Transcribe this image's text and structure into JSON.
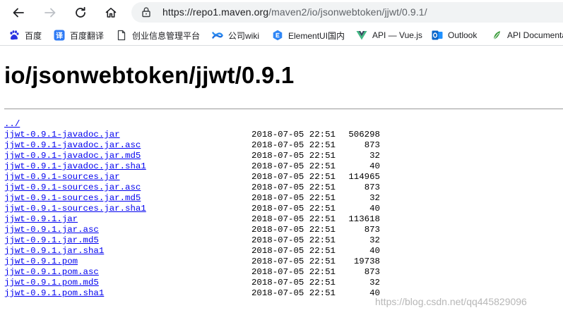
{
  "browser": {
    "url_host": "https://repo1.maven.org",
    "url_path": "/maven2/io/jsonwebtoken/jjwt/0.9.1/"
  },
  "bookmarks": [
    {
      "label": "百度",
      "icon": "baidu-paw-icon",
      "color": "#2932e1"
    },
    {
      "label": "百度翻译",
      "icon": "baidu-translate-icon",
      "color": "#2f7bf5"
    },
    {
      "label": "创业信息管理平台",
      "icon": "page-icon",
      "color": "#5f6368"
    },
    {
      "label": "公司wiki",
      "icon": "confluence-icon",
      "color": "#1d6fe0"
    },
    {
      "label": "ElementUI国内",
      "icon": "element-icon",
      "color": "#2f86f6"
    },
    {
      "label": "API — Vue.js",
      "icon": "vue-icon",
      "color": "#42b883"
    },
    {
      "label": "Outlook",
      "icon": "outlook-icon",
      "color": "#0a64c8"
    },
    {
      "label": "API Documenta",
      "icon": "leaf-icon",
      "color": "#3a9b3a"
    }
  ],
  "page": {
    "title": "io/jsonwebtoken/jjwt/0.9.1",
    "parent_link": "../",
    "files": [
      {
        "name": "jjwt-0.9.1-javadoc.jar",
        "date": "2018-07-05 22:51",
        "size": "506298"
      },
      {
        "name": "jjwt-0.9.1-javadoc.jar.asc",
        "date": "2018-07-05 22:51",
        "size": "873"
      },
      {
        "name": "jjwt-0.9.1-javadoc.jar.md5",
        "date": "2018-07-05 22:51",
        "size": "32"
      },
      {
        "name": "jjwt-0.9.1-javadoc.jar.sha1",
        "date": "2018-07-05 22:51",
        "size": "40"
      },
      {
        "name": "jjwt-0.9.1-sources.jar",
        "date": "2018-07-05 22:51",
        "size": "114965"
      },
      {
        "name": "jjwt-0.9.1-sources.jar.asc",
        "date": "2018-07-05 22:51",
        "size": "873"
      },
      {
        "name": "jjwt-0.9.1-sources.jar.md5",
        "date": "2018-07-05 22:51",
        "size": "32"
      },
      {
        "name": "jjwt-0.9.1-sources.jar.sha1",
        "date": "2018-07-05 22:51",
        "size": "40"
      },
      {
        "name": "jjwt-0.9.1.jar",
        "date": "2018-07-05 22:51",
        "size": "113618"
      },
      {
        "name": "jjwt-0.9.1.jar.asc",
        "date": "2018-07-05 22:51",
        "size": "873"
      },
      {
        "name": "jjwt-0.9.1.jar.md5",
        "date": "2018-07-05 22:51",
        "size": "32"
      },
      {
        "name": "jjwt-0.9.1.jar.sha1",
        "date": "2018-07-05 22:51",
        "size": "40"
      },
      {
        "name": "jjwt-0.9.1.pom",
        "date": "2018-07-05 22:51",
        "size": "19738"
      },
      {
        "name": "jjwt-0.9.1.pom.asc",
        "date": "2018-07-05 22:51",
        "size": "873"
      },
      {
        "name": "jjwt-0.9.1.pom.md5",
        "date": "2018-07-05 22:51",
        "size": "32"
      },
      {
        "name": "jjwt-0.9.1.pom.sha1",
        "date": "2018-07-05 22:51",
        "size": "40"
      }
    ]
  },
  "watermark": "https://blog.csdn.net/qq445829096"
}
